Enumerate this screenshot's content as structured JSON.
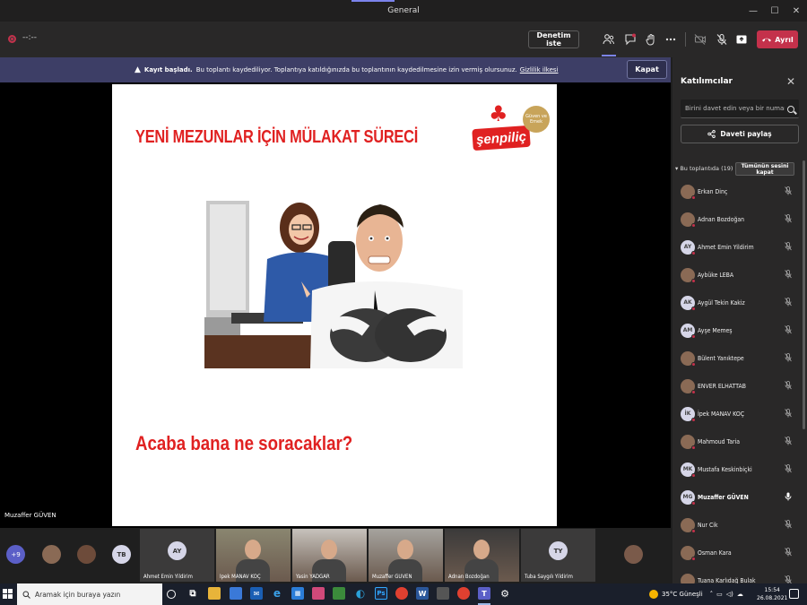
{
  "window": {
    "title": "General",
    "controls": [
      "—",
      "☐",
      "✕"
    ]
  },
  "toolbar": {
    "timer": "--:--",
    "admit_button": "Denetim iste",
    "leave_button": "Ayrıl",
    "icons": [
      "people-icon",
      "chat-icon",
      "raise-hand-icon",
      "more-icon",
      "camera-off-icon",
      "mic-off-icon",
      "share-icon"
    ]
  },
  "banner": {
    "title": "Kayıt başladı.",
    "message": "Bu toplantı kaydediliyor. Toplantıya katıldığınızda bu toplantının kaydedilmesine izin vermiş olursunuz.",
    "link": "Gizlilik ilkesi",
    "close_button": "Kapat"
  },
  "slide": {
    "title": "YENİ MEZUNLAR İÇİN MÜLAKAT SÜRECİ",
    "question": "Acaba bana ne soracaklar?",
    "logo_text": "şenpiliç",
    "badge_text": "Güven ve Emek"
  },
  "self_name": "Muzaffer GÜVEN",
  "panel": {
    "title": "Katılımcılar",
    "invite_placeholder": "Birini davet edin veya bir numara çevirin",
    "share_invite": "Daveti paylaş",
    "in_meeting": "Bu toplantıda (19)",
    "mute_all": "Tümünün sesini kapat",
    "participants": [
      {
        "name": "Erkan Dinç",
        "initials": "",
        "photo": true,
        "speaking": false
      },
      {
        "name": "Adnan Bozdoğan",
        "initials": "",
        "photo": true,
        "speaking": false
      },
      {
        "name": "Ahmet Emin Yildirim",
        "initials": "AY",
        "photo": false,
        "speaking": false
      },
      {
        "name": "Aybüke LEBA",
        "initials": "",
        "photo": true,
        "speaking": false
      },
      {
        "name": "Aygül Tekin Kakiz",
        "initials": "AK",
        "photo": false,
        "speaking": false
      },
      {
        "name": "Ayşe Memeş",
        "initials": "AM",
        "photo": false,
        "speaking": false
      },
      {
        "name": "Bülent Yanıktepe",
        "initials": "",
        "photo": true,
        "speaking": false
      },
      {
        "name": "ENVER ELHATTAB",
        "initials": "",
        "photo": true,
        "speaking": false
      },
      {
        "name": "İpek MANAV KOÇ",
        "initials": "İK",
        "photo": false,
        "speaking": false
      },
      {
        "name": "Mahmoud Taria",
        "initials": "",
        "photo": true,
        "speaking": false
      },
      {
        "name": "Mustafa Keskinbiçki",
        "initials": "MK",
        "photo": false,
        "speaking": false
      },
      {
        "name": "Muzaffer GÜVEN",
        "initials": "MG",
        "photo": false,
        "speaking": true
      },
      {
        "name": "Nur Cik",
        "initials": "",
        "photo": true,
        "speaking": false
      },
      {
        "name": "Osman Kara",
        "initials": "",
        "photo": true,
        "speaking": false
      },
      {
        "name": "Tuana Karlıdağ Bulak",
        "initials": "",
        "photo": true,
        "speaking": false
      }
    ]
  },
  "gallery": {
    "more_count": "+9",
    "initial_avatar": "TB",
    "tiles": [
      {
        "name": "Ahmet Emin Yildirim",
        "initials": "AY",
        "video": false
      },
      {
        "name": "İpek MANAV KOÇ",
        "initials": "",
        "video": true
      },
      {
        "name": "Yasin YADGAR",
        "initials": "",
        "video": true
      },
      {
        "name": "Muzaffer GÜVEN",
        "initials": "",
        "video": true
      },
      {
        "name": "Adnan Bozdoğan",
        "initials": "",
        "video": true
      },
      {
        "name": "Tuba Saygılı Yildirim",
        "initials": "TY",
        "video": false
      }
    ]
  },
  "taskbar": {
    "search_placeholder": "Aramak için buraya yazın",
    "weather": "35°C Güneşli",
    "time": "15:54",
    "date": "26.08.2021"
  },
  "colors": {
    "accent": "#7b83eb",
    "leave": "#c4314b",
    "banner": "#3d3e66",
    "slide_red": "#e02121"
  }
}
